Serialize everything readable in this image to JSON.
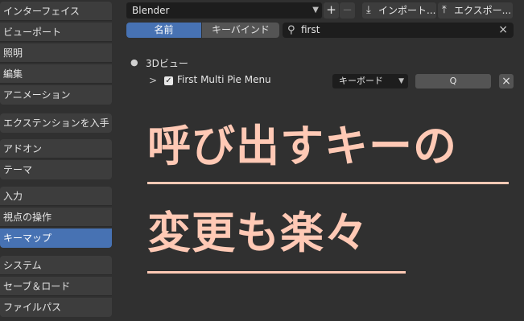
{
  "sidebar": {
    "items": [
      {
        "label": "インターフェイス"
      },
      {
        "label": "ビューポート"
      },
      {
        "label": "照明"
      },
      {
        "label": "編集"
      },
      {
        "label": "アニメーション"
      },
      {
        "label": "エクステンションを入手"
      },
      {
        "label": "アドオン"
      },
      {
        "label": "テーマ"
      },
      {
        "label": "入力"
      },
      {
        "label": "視点の操作"
      },
      {
        "label": "キーマップ",
        "active": true
      },
      {
        "label": "システム"
      },
      {
        "label": "セーブ＆ロード"
      },
      {
        "label": "ファイルパス"
      }
    ]
  },
  "toolbar": {
    "preset_value": "Blender",
    "add_label": "+",
    "remove_label": "−",
    "import_label": "インポート...",
    "export_label": "エクスポー..."
  },
  "filter": {
    "mode_name": "名前",
    "mode_key": "キーバインド",
    "search_value": "first",
    "clear_icon": "×"
  },
  "keymap": {
    "section": "3Dビュー",
    "item_name": "First Multi Pie Menu",
    "item_enabled": true,
    "input_type": "キーボード",
    "key": "Q",
    "remove_icon": "×"
  },
  "overlay": {
    "line1": "呼び出すキーの",
    "line2": "変更も楽々",
    "color": "#ffc9b5"
  },
  "colors": {
    "accent": "#4772b3",
    "background": "#303030",
    "sidebar_item": "#3d3d3d",
    "field": "#1d1d1d"
  }
}
